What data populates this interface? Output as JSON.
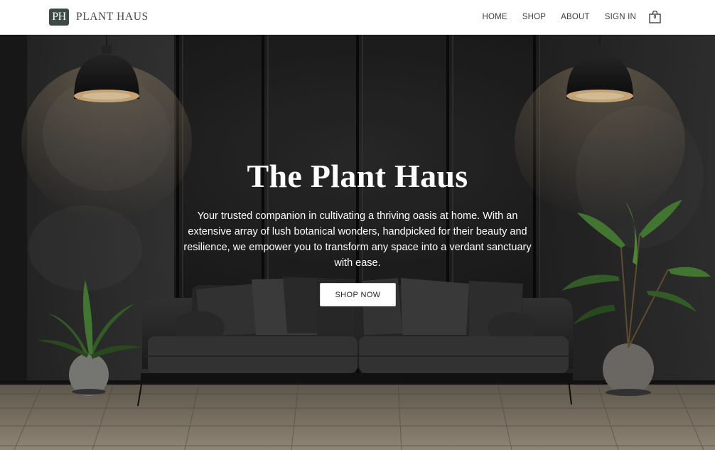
{
  "brand": {
    "logo_initials": "PH",
    "name": "PLANT HAUS"
  },
  "nav": {
    "items": [
      "HOME",
      "SHOP",
      "ABOUT",
      "SIGN IN"
    ],
    "cart_count": "0",
    "cart_icon": "shopping-bag-icon"
  },
  "hero": {
    "title": "The Plant Haus",
    "description": "Your trusted companion in cultivating a thriving oasis at home. With an extensive array of lush botanical wonders, handpicked for their beauty and resilience, we empower you to transform any space into a verdant sanctuary with ease.",
    "cta_label": "SHOP NOW"
  },
  "colors": {
    "header_bg": "#ffffff",
    "logo_badge": "#3d4a45",
    "hero_overlay_text": "#ffffff",
    "button_bg": "#ffffff"
  }
}
